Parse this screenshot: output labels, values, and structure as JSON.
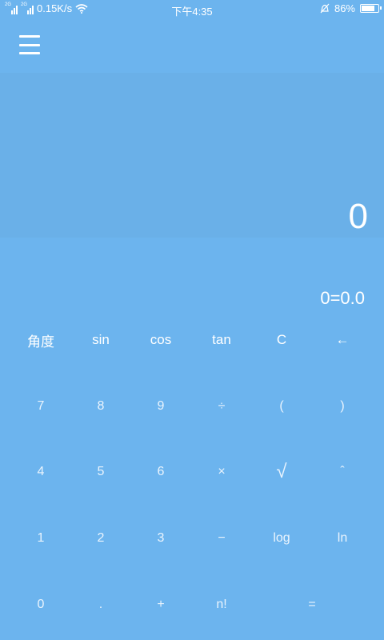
{
  "status_bar": {
    "network_label": "2G",
    "speed": "0.15K/s",
    "time": "下午4:35",
    "battery": "86%",
    "battery_level": 0.86
  },
  "display": {
    "value": "0",
    "result": "0=0.0"
  },
  "keypad": {
    "function_row": [
      "角度",
      "sin",
      "cos",
      "tan",
      "C",
      "←"
    ],
    "row1": [
      "7",
      "8",
      "9",
      "÷",
      "(",
      ")"
    ],
    "row2": [
      "4",
      "5",
      "6",
      "×",
      "√",
      "ˆ"
    ],
    "row3": [
      "1",
      "2",
      "3",
      "−",
      "log",
      "ln"
    ],
    "row4": [
      "0",
      ".",
      "+",
      "n!",
      "="
    ]
  },
  "colors": {
    "background": "#6cb4ee",
    "display_panel": "#6ab0e8",
    "text": "#ffffff"
  },
  "icons": {
    "menu": "hamburger-menu-icon",
    "signal": "signal-icon",
    "wifi": "wifi-icon",
    "silent": "bell-off-icon",
    "battery": "battery-icon"
  }
}
